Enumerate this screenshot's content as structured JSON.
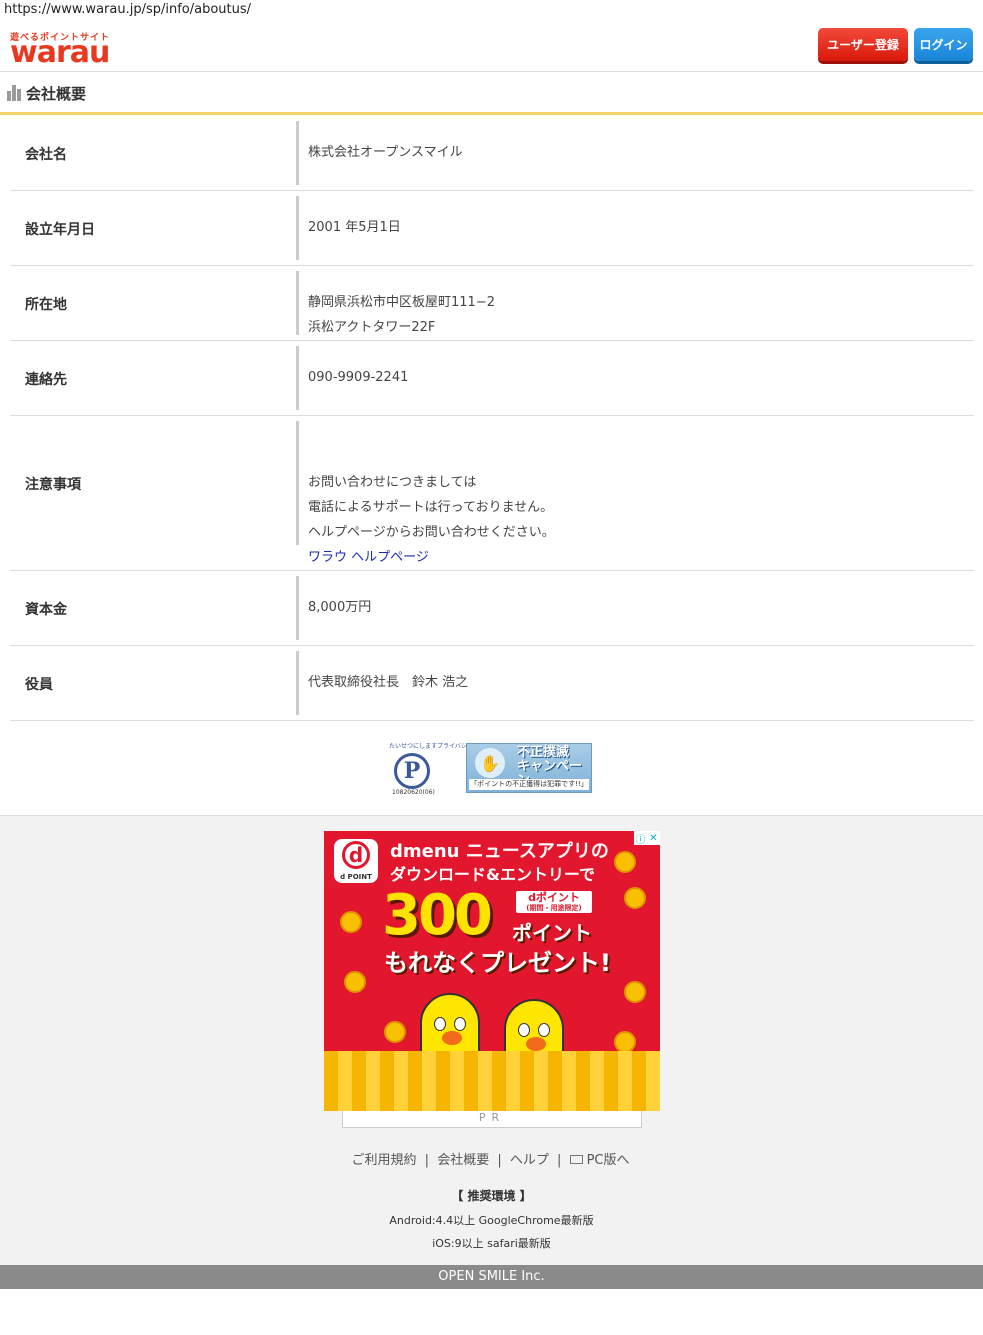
{
  "browser": {
    "url": "https://www.warau.jp/sp/info/aboutus/"
  },
  "header": {
    "logo_tagline": "遊べるポイントサイト",
    "logo_word": "warau",
    "register_label": "ユーザー登録",
    "login_label": "ログイン"
  },
  "page": {
    "title": "会社概要"
  },
  "company": {
    "rows": [
      {
        "label": "会社名",
        "lines": [
          "株式会社オープンスマイル"
        ]
      },
      {
        "label": "設立年月日",
        "lines": [
          "2001 年5月1日"
        ]
      },
      {
        "label": "所在地",
        "lines": [
          "静岡県浜松市中区板屋町111−2",
          "浜松アクトタワー22F"
        ]
      },
      {
        "label": "連絡先",
        "lines": [
          "090-9909-2241"
        ]
      },
      {
        "label": "注意事項",
        "lines": [
          "お問い合わせにつきましては",
          "電話によるサポートは行っておりません。",
          "ヘルプページからお問い合わせください。"
        ],
        "link": "ワラウ ヘルプページ"
      },
      {
        "label": "資本金",
        "lines": [
          "8,000万円"
        ]
      },
      {
        "label": "役員",
        "lines": [
          "代表取締役社長　鈴木 浩之"
        ]
      }
    ]
  },
  "badges": {
    "privacy_top": "たいせつにしますプライバシー",
    "privacy_letter": "P",
    "privacy_number": "10820620(06)",
    "fraud_title_1": "不正撲滅",
    "fraud_title_2": "キャンペーン",
    "fraud_sub": "「ポイントの不正獲得は犯罪です!!」"
  },
  "ad": {
    "close_icons": [
      "info-icon",
      "close-icon"
    ],
    "close_info": "ⓘ",
    "close_x": "✕",
    "d_letter": "d",
    "d_brand": "d POINT",
    "line1": "dmenu ニュースアプリの",
    "line2": "ダウンロード&エントリーで",
    "big_number": "300",
    "dpoint_a": "dポイント",
    "dpoint_b": "(期間・用途限定)",
    "point_word": "ポイント",
    "present": "もれなくプレゼント!",
    "pr_label": "PR"
  },
  "footer": {
    "links": [
      "ご利用規約",
      "会社概要",
      "ヘルプ",
      "PC版へ"
    ],
    "separator": "|",
    "env_title": "【 推奨環境 】",
    "env_android": "Android:4.4以上 GoogleChrome最新版",
    "env_ios": "iOS:9以上 safari最新版",
    "copyright": "OPEN SMILE Inc."
  },
  "colors": {
    "brand_red": "#e8381f",
    "register_button": "#e52212",
    "login_button": "#2896e6",
    "title_underline": "#f4d36a",
    "link_blue": "#1a2bb0",
    "footer_bar": "#8a8a8a"
  }
}
